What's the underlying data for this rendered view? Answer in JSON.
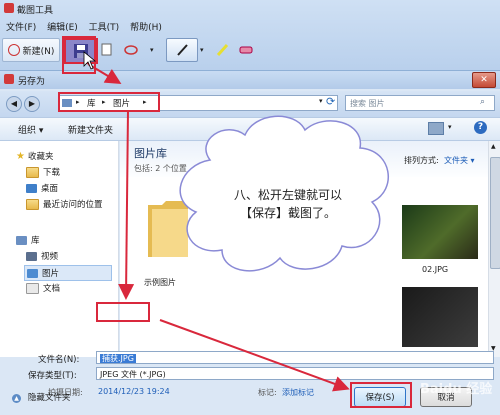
{
  "snip": {
    "title": "截图工具",
    "menu": [
      "文件(F)",
      "编辑(E)",
      "工具(T)",
      "帮助(H)"
    ],
    "new_label": "新建(N)"
  },
  "dialog": {
    "title": "另存为",
    "breadcrumb": [
      "库",
      "图片"
    ],
    "search_placeholder": "搜索 图片",
    "organize_label": "组织",
    "new_folder_label": "新建文件夹",
    "library_title": "图片库",
    "library_subtitle": "包括: 2 个位置",
    "arrange_label": "排列方式:",
    "arrange_value": "文件夹",
    "nav": {
      "favorites_label": "收藏夹",
      "favorites": [
        "下载",
        "桌面",
        "最近访问的位置"
      ],
      "library_label": "库",
      "libraries": [
        "视频",
        "图片",
        "文档"
      ]
    },
    "files": [
      {
        "name": "示例图片",
        "kind": "folder"
      },
      {
        "name": "02.JPG",
        "kind": "image"
      }
    ],
    "filename_label": "文件名(N):",
    "filename_value": "捕获.JPG",
    "filetype_label": "保存类型(T):",
    "filetype_value": "JPEG 文件 (*.JPG)",
    "date_label": "拍摄日期:",
    "date_value": "2014/12/23 19:24",
    "tags_label": "标记:",
    "tags_value": "添加标记",
    "hide_folders_label": "隐藏文件夹",
    "save_label": "保存(S)",
    "cancel_label": "取消"
  },
  "callout": {
    "line1": "八、松开左键就可以",
    "line2": "【保存】截图了。"
  },
  "watermark": "Baidu 经验",
  "colors": {
    "annotation_red": "#d9283c",
    "link_blue": "#1e5eb8"
  }
}
